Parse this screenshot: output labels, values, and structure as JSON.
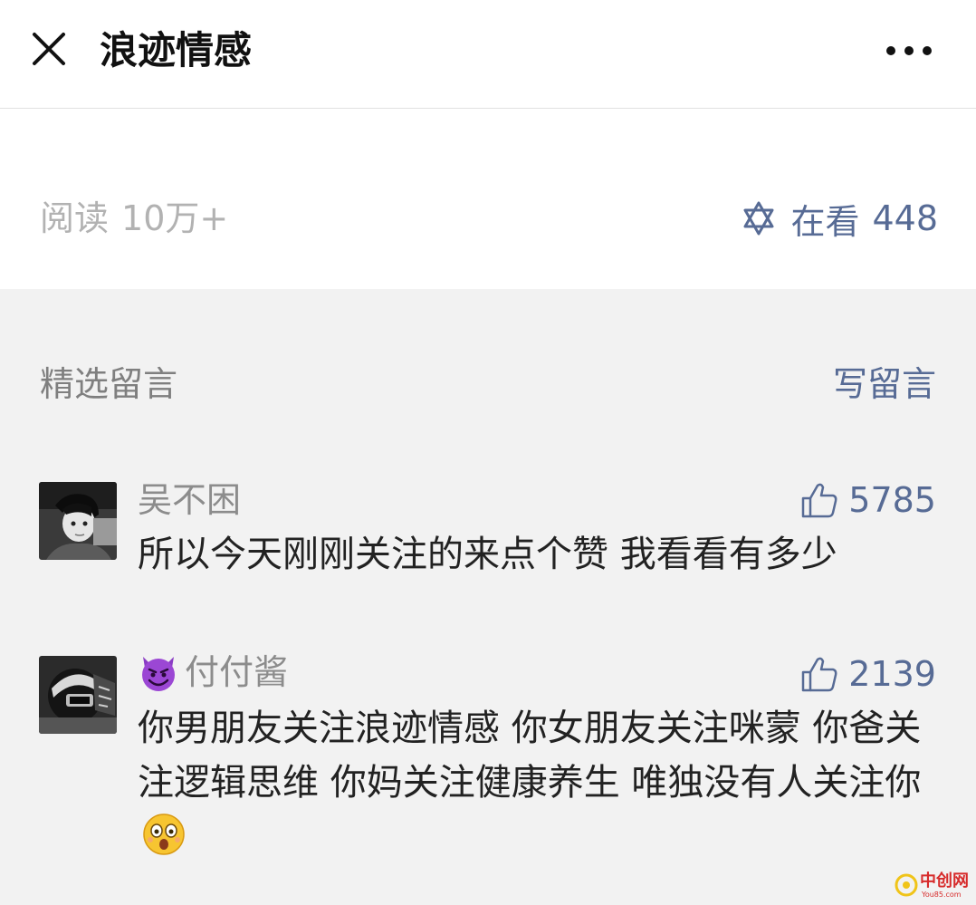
{
  "header": {
    "title": "浪迹情感",
    "close_icon": "close-icon",
    "more_icon": "more-dots-icon"
  },
  "stats": {
    "reads_label": "阅读",
    "reads_value": "10万+",
    "watching_label": "在看",
    "watching_value": "448",
    "watching_icon": "star-of-david-icon"
  },
  "comments_section": {
    "title": "精选留言",
    "write_label": "写留言",
    "items": [
      {
        "nickname": "吴不困",
        "likes": "5785",
        "content": "所以今天刚刚关注的来点个赞 我看看有多少"
      },
      {
        "nickname": "付付酱",
        "nickname_emoji": "smiling-devil-emoji",
        "likes": "2139",
        "content": "你男朋友关注浪迹情感 你女朋友关注咪蒙 你爸关注逻辑思维 你妈关注健康养生 唯独没有人关注你",
        "trailing_emoji": "flushed-face-emoji"
      }
    ]
  },
  "watermark": {
    "text": "中创网",
    "subtext": "You85.com"
  },
  "colors": {
    "link": "#576b95",
    "muted": "#b2b2b2",
    "background": "#f2f2f2",
    "text": "#222222"
  }
}
